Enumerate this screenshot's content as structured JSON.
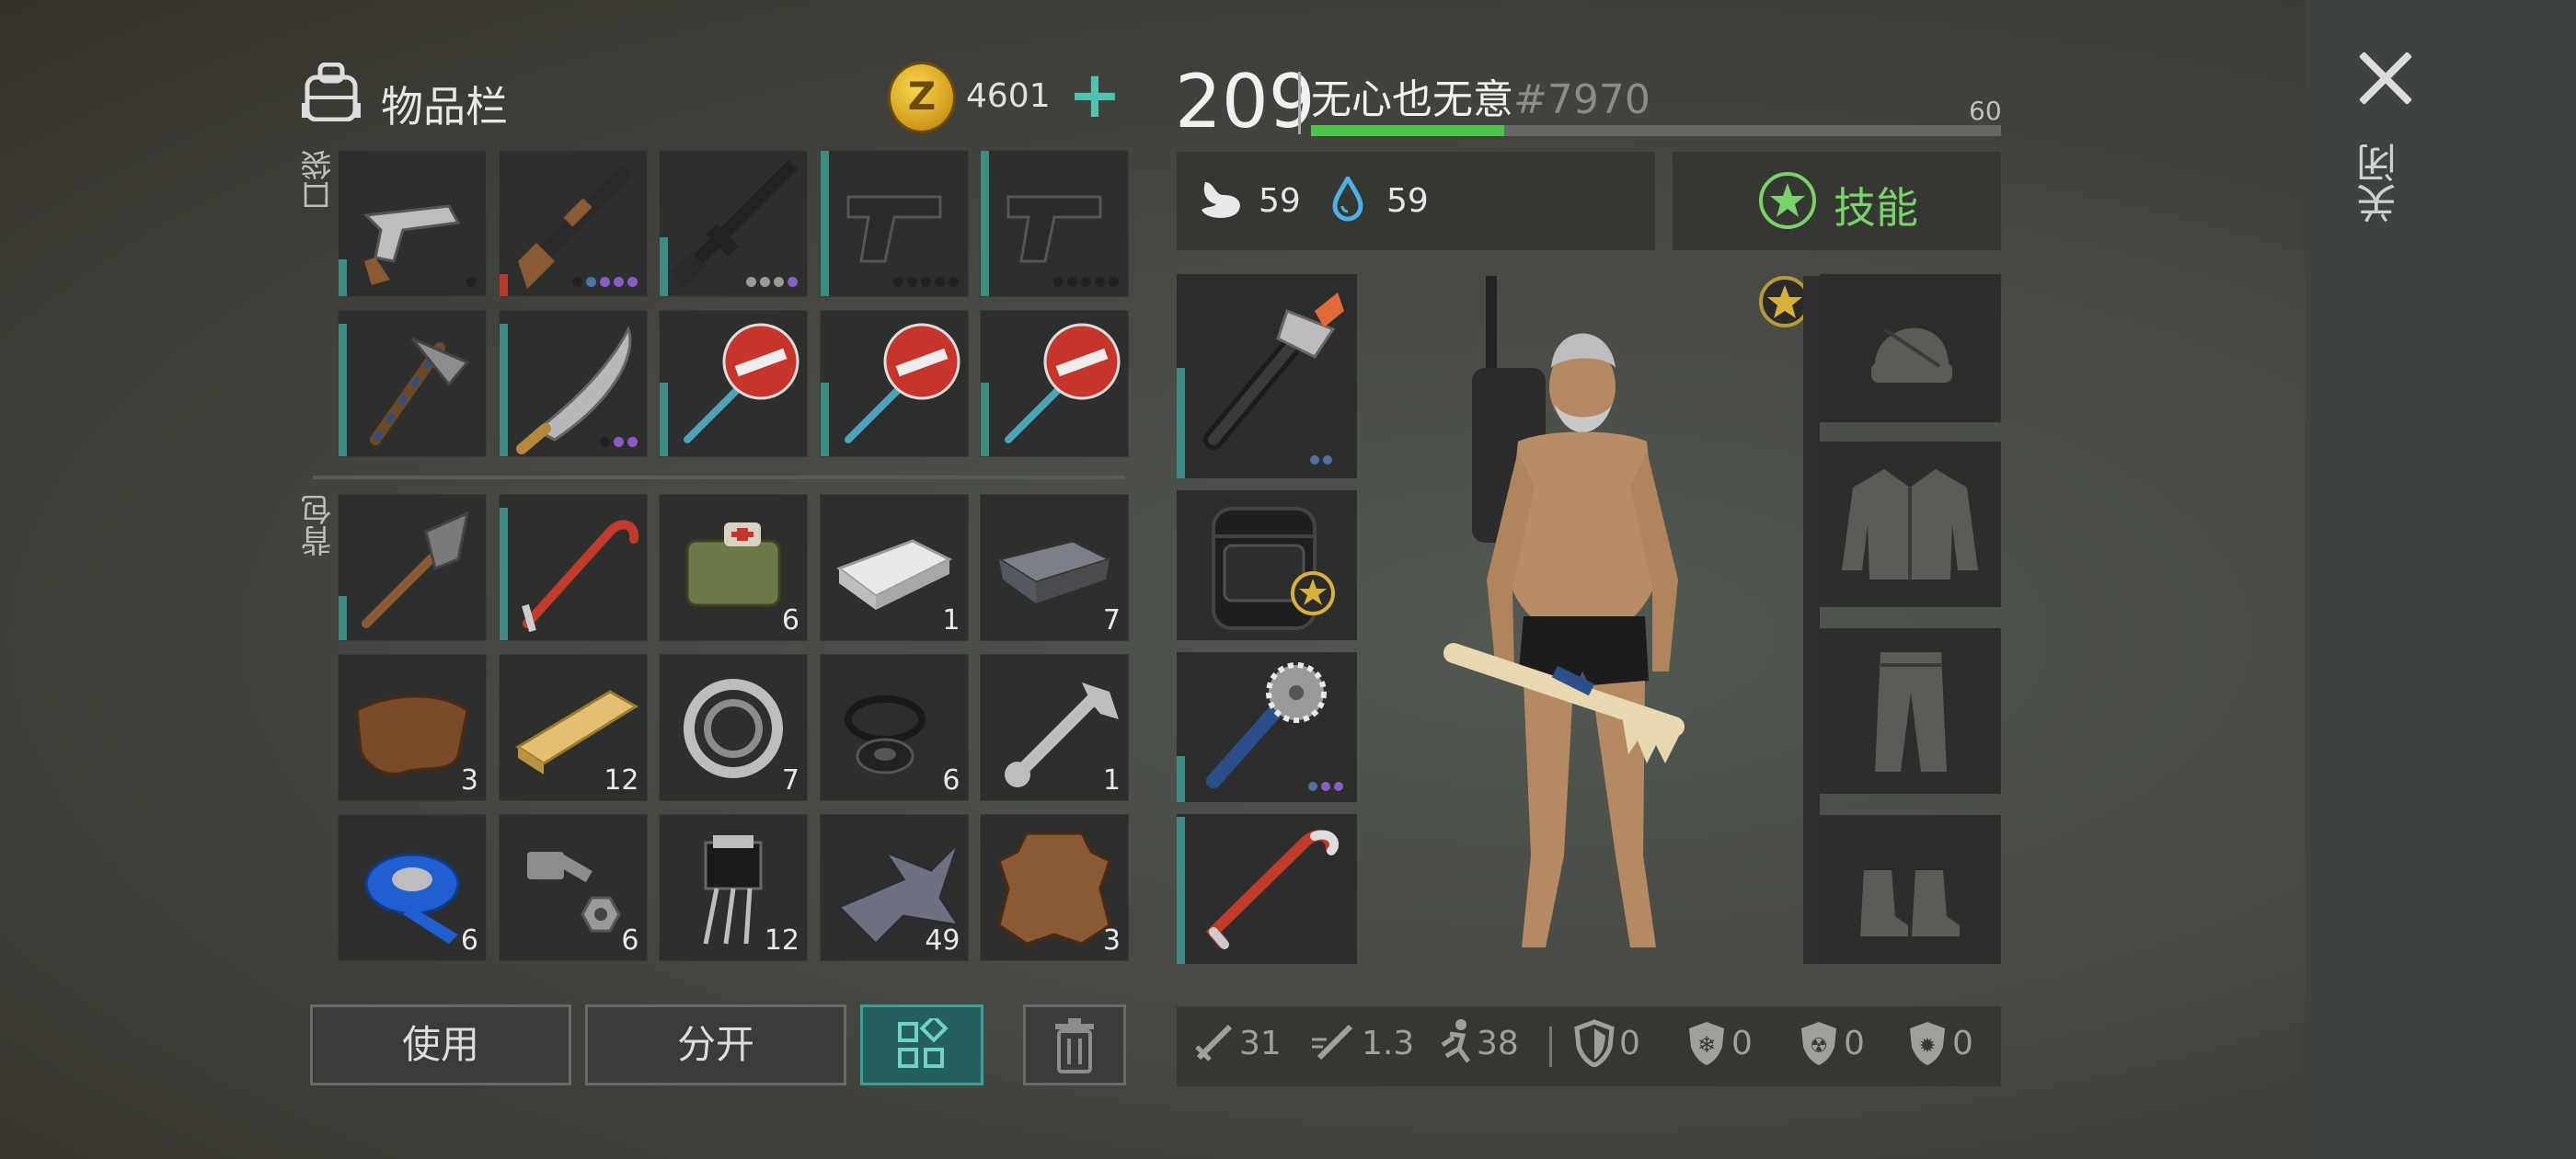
{
  "inventory": {
    "title": "物品栏",
    "currency_value": "4601",
    "currency_icon": "z-coin-icon",
    "add_button": "+",
    "pocket_label": "口袋",
    "backpack_label": "背包",
    "pocket_slots": [
      {
        "item": "revolver",
        "count": "",
        "durability": 0.25,
        "dots": [
          "#222"
        ]
      },
      {
        "item": "shotgun",
        "count": "",
        "durability": 0.15,
        "bar": "red",
        "dots": [
          "#222",
          "#4e72a8",
          "#8a5cc8",
          "#8a5cc8",
          "#8a5cc8"
        ]
      },
      {
        "item": "assault-rifle",
        "count": "",
        "durability": 0.4,
        "dots": [
          "#999",
          "#999",
          "#999",
          "#8a5cc8"
        ]
      },
      {
        "item": "pistol",
        "count": "",
        "durability": 1.0,
        "dots": [
          "#222",
          "#222",
          "#222",
          "#222",
          "#222"
        ]
      },
      {
        "item": "pistol",
        "count": "",
        "durability": 1.0,
        "dots": [
          "#222",
          "#222",
          "#222",
          "#222",
          "#222"
        ]
      },
      {
        "item": "hatchet",
        "count": "",
        "durability": 0.9,
        "dots": []
      },
      {
        "item": "machete",
        "count": "",
        "durability": 0.9,
        "dots": [
          "#222",
          "#8a5cc8",
          "#8a5cc8"
        ]
      },
      {
        "item": "stop-sign",
        "count": "",
        "durability": 0.5,
        "dots": []
      },
      {
        "item": "stop-sign",
        "count": "",
        "durability": 0.5,
        "dots": []
      },
      {
        "item": "stop-sign",
        "count": "",
        "durability": 0.5,
        "dots": []
      }
    ],
    "backpack_slots": [
      {
        "item": "shovel",
        "count": "",
        "durability": 0.3
      },
      {
        "item": "crowbar",
        "count": "",
        "durability": 0.9
      },
      {
        "item": "medkit-bag",
        "count": "6"
      },
      {
        "item": "aluminum-bar",
        "count": "1"
      },
      {
        "item": "iron-ingot",
        "count": "7"
      },
      {
        "item": "leather",
        "count": "3"
      },
      {
        "item": "wooden-plank",
        "count": "12"
      },
      {
        "item": "bearing",
        "count": "7"
      },
      {
        "item": "rubber-parts",
        "count": "6"
      },
      {
        "item": "wrench",
        "count": "1"
      },
      {
        "item": "duct-tape",
        "count": "6"
      },
      {
        "item": "nuts-bolts",
        "count": "6"
      },
      {
        "item": "transistor",
        "count": "12"
      },
      {
        "item": "scrap-metal",
        "count": "49"
      },
      {
        "item": "animal-hide",
        "count": "3"
      }
    ],
    "buttons": {
      "use": "使用",
      "split": "分开"
    }
  },
  "player": {
    "level": "209",
    "name": "无心也无意",
    "tag": "#7970",
    "xp_max": "60",
    "xp_progress": 0.28,
    "food": "59",
    "water": "59",
    "skills_label": "技能"
  },
  "stats": {
    "damage": "31",
    "attack_speed": "1.3",
    "speed": "38",
    "armor": "0",
    "cold_resist": "0",
    "radiation_resist": "0",
    "toxic_resist": "0"
  },
  "close_label": "关闭",
  "colors": {
    "accent": "#3e8b82",
    "xp": "#4cc34a",
    "skill": "#7ad36a",
    "coin": "#e2b22e"
  }
}
